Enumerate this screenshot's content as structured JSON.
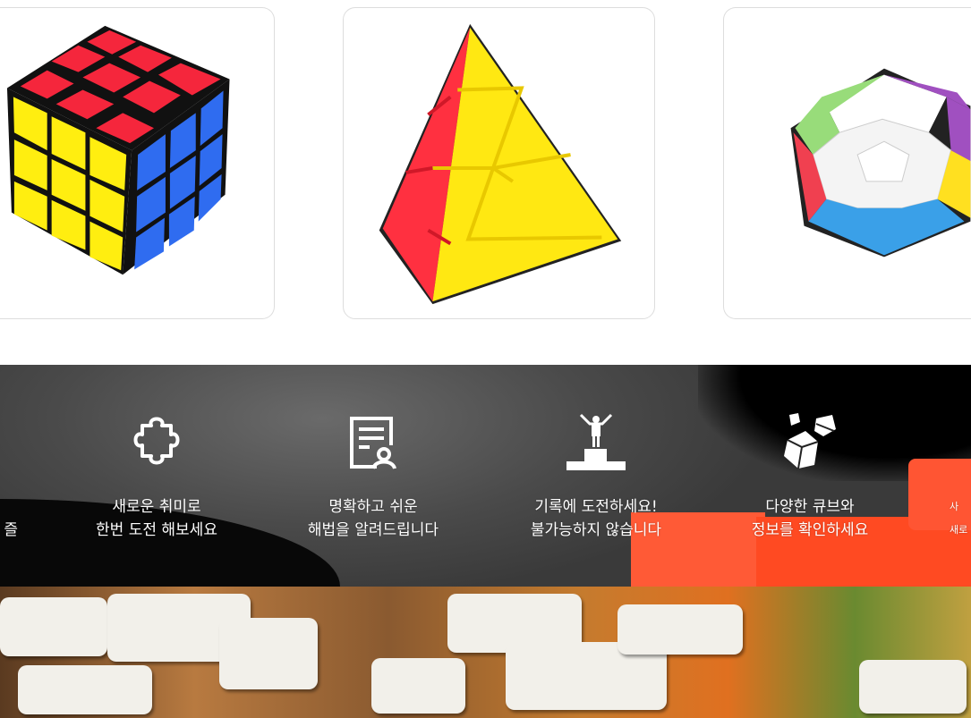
{
  "products": [
    {
      "name": "3x3 cube"
    },
    {
      "name": "pyraminx"
    },
    {
      "name": "megaminx"
    }
  ],
  "features": [
    {
      "icon": "partial",
      "line1": "",
      "line2": "즐"
    },
    {
      "icon": "puzzle-piece-icon",
      "line1": "새로운 취미로",
      "line2": "한번 도전 해보세요"
    },
    {
      "icon": "document-user-icon",
      "line1": "명확하고 쉬운",
      "line2": "해법을 알려드립니다"
    },
    {
      "icon": "podium-winner-icon",
      "line1": "기록에 도전하세요!",
      "line2": "불가능하지 않습니다"
    },
    {
      "icon": "cubes-icon",
      "line1": "다양한 큐브와",
      "line2": "정보를 확인하세요"
    },
    {
      "icon": "partial",
      "line1": "사",
      "line2": "새로"
    }
  ]
}
